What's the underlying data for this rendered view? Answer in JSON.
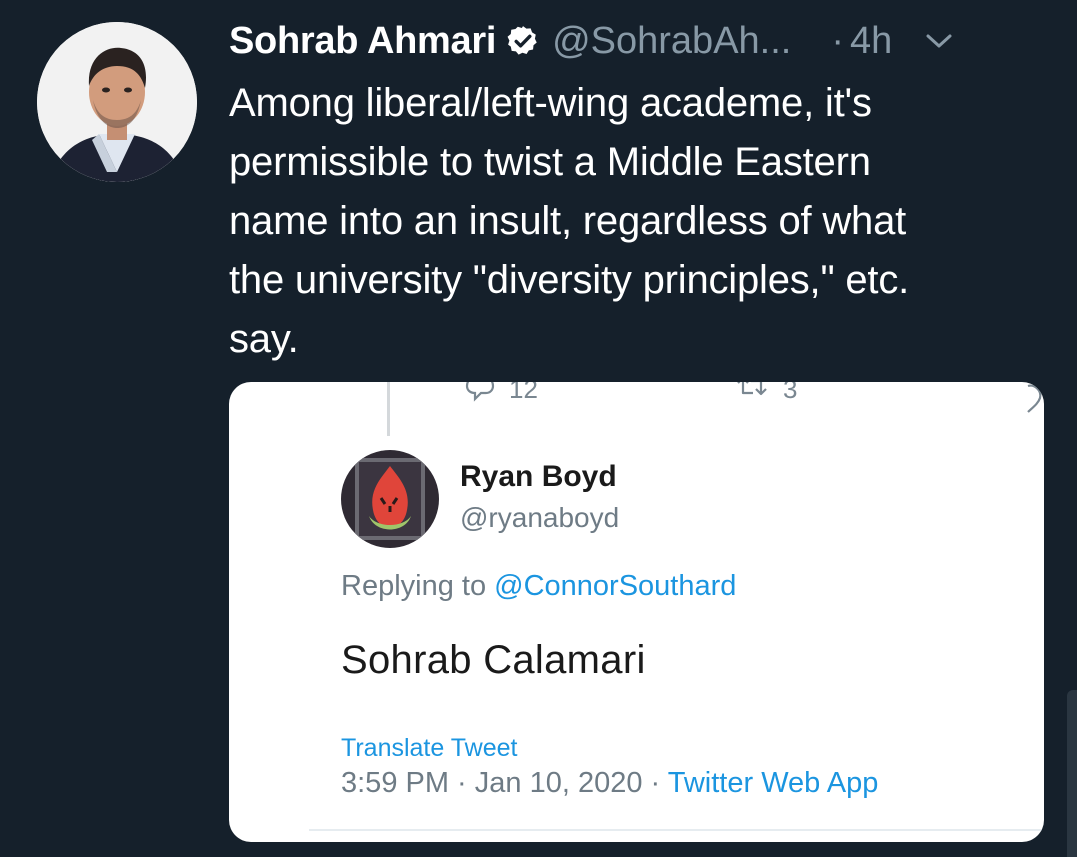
{
  "tweet": {
    "author_name": "Sohrab Ahmari",
    "handle": "@SohrabAh...",
    "separator": "·",
    "time": "4h",
    "text_lines": [
      "Among liberal/left-wing academe, it's",
      "permissible to twist a Middle Eastern",
      "name into an insult, regardless of what",
      "the university \"diversity principles,\" etc.",
      "say."
    ]
  },
  "embedded": {
    "reply_count": "12",
    "retweet_count": "3",
    "author_name": "Ryan Boyd",
    "handle": "@ryanaboyd",
    "replying_prefix": "Replying to",
    "replying_to": "@ConnorSouthard",
    "text": "Sohrab Calamari",
    "translate_label": "Translate Tweet",
    "timestamp": "3:59 PM · Jan 10, 2020 ·",
    "source_app": "Twitter Web App"
  },
  "colors": {
    "background": "#15202b",
    "secondary_text": "#8899a6",
    "link": "#1b95e0",
    "verified_badge": "#ffffff"
  },
  "icons": [
    "verified-badge-icon",
    "chevron-down-icon",
    "reply-icon",
    "retweet-icon"
  ]
}
